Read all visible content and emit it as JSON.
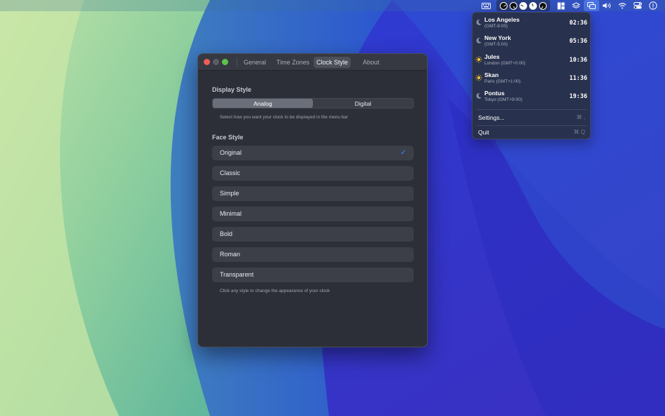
{
  "menubar": {
    "icons": [
      "keyboard-icon",
      "clock-icon",
      "clock-icon",
      "clock-icon",
      "clock-icon",
      "clock-icon",
      "window-layout-icon",
      "layers-icon",
      "app-window-icon",
      "volume-icon",
      "wifi-icon",
      "control-center-icon",
      "info-icon"
    ],
    "clock_hands": [
      {
        "style": "dark",
        "angle": 60
      },
      {
        "style": "dark",
        "angle": 150
      },
      {
        "style": "light",
        "angle": 300
      },
      {
        "style": "light",
        "angle": 340
      },
      {
        "style": "dark",
        "angle": 210
      }
    ]
  },
  "dropdown": {
    "time_zones": [
      {
        "name": "Los Angeles",
        "sub": "(GMT-8:00)",
        "time": "02:36",
        "icon": "moon-icon"
      },
      {
        "name": "New York",
        "sub": "(GMT-5:00)",
        "time": "05:36",
        "icon": "moon-icon"
      },
      {
        "name": "Jules",
        "sub": "London (GMT+0:00)",
        "time": "10:36",
        "icon": "sun-icon"
      },
      {
        "name": "Skan",
        "sub": "Paris (GMT+1:00)",
        "time": "11:36",
        "icon": "sun-icon"
      },
      {
        "name": "Pontus",
        "sub": "Tokyo (GMT+9:00)",
        "time": "19:36",
        "icon": "moon-icon"
      }
    ],
    "settings_label": "Settings...",
    "settings_shortcut": "⌘ ,",
    "quit_label": "Quit",
    "quit_shortcut": "⌘ Q"
  },
  "window": {
    "tabs": [
      {
        "label": "General"
      },
      {
        "label": "Time Zones"
      },
      {
        "label": "Clock Style"
      },
      {
        "label": "About"
      }
    ],
    "active_tab": "Clock Style",
    "display_style": {
      "title": "Display Style",
      "options": [
        "Analog",
        "Digital"
      ],
      "selected": "Analog",
      "hint": "Select how you want your clock to be displayed in the menu bar"
    },
    "face_style": {
      "title": "Face Style",
      "options": [
        "Original",
        "Classic",
        "Simple",
        "Minimal",
        "Bold",
        "Roman",
        "Transparent"
      ],
      "selected": "Original",
      "check": "✓",
      "hint": "Click any style to change the appearance of your clock"
    }
  },
  "colors": {
    "accent": "#3b82f6",
    "close": "#ee5f58",
    "maximize": "#5fc24a"
  }
}
